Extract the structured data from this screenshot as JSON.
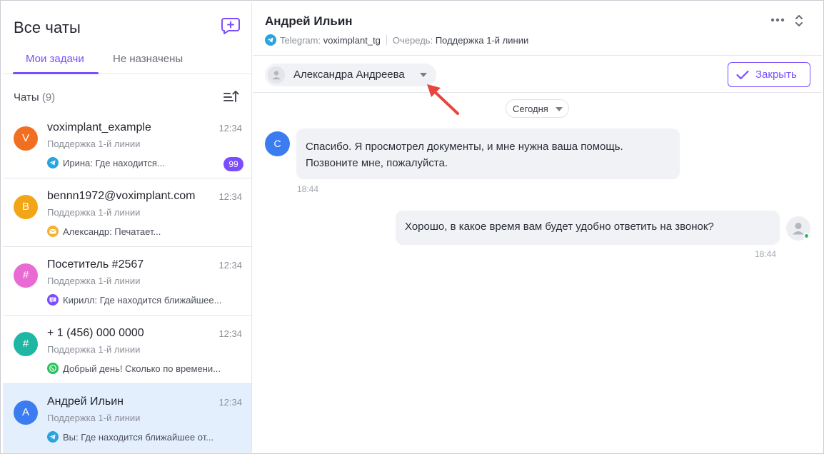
{
  "sidebar": {
    "title": "Все чаты",
    "tabs": [
      {
        "label": "Мои задачи",
        "active": true
      },
      {
        "label": "Не назначены",
        "active": false
      }
    ],
    "chats_label": "Чаты",
    "chats_count": "(9)",
    "chats": [
      {
        "initial": "V",
        "avatar_color": "#f26f21",
        "name": "voximplant_example",
        "time": "12:34",
        "queue": "Поддержка 1-й линии",
        "channel_icon": "telegram-icon",
        "last_message": "Ирина: Где находится...",
        "unread": "99",
        "selected": false
      },
      {
        "initial": "B",
        "avatar_color": "#f2a516",
        "name": "bennn1972@voximplant.com",
        "time": "12:34",
        "queue": "Поддержка 1-й линии",
        "channel_icon": "email-icon",
        "last_message": "Александр: Печатает...",
        "unread": null,
        "selected": false
      },
      {
        "initial": "#",
        "avatar_color": "#e96ad3",
        "name": "Посетитель #2567",
        "time": "12:34",
        "queue": "Поддержка 1-й линии",
        "channel_icon": "webchat-icon",
        "last_message": "Кирилл: Где находится ближайшее...",
        "unread": null,
        "selected": false
      },
      {
        "initial": "#",
        "avatar_color": "#1fb7a3",
        "name": "+ 1 (456) 000 0000",
        "time": "12:34",
        "queue": "Поддержка 1-й линии",
        "channel_icon": "whatsapp-icon",
        "last_message": "Добрый день! Сколько по времени...",
        "unread": null,
        "selected": false
      },
      {
        "initial": "А",
        "avatar_color": "#3b7cf0",
        "name": "Андрей Ильин",
        "time": "12:34",
        "queue": "Поддержка 1-й линии",
        "channel_icon": "telegram-icon",
        "last_message": "Вы: Где находится ближайшее от...",
        "unread": null,
        "selected": true
      }
    ]
  },
  "header": {
    "contact_name": "Андрей Ильин",
    "channel_key": "Telegram:",
    "channel_value": "voximplant_tg",
    "queue_key": "Очередь:",
    "queue_value": "Поддержка 1-й линии"
  },
  "assignee": {
    "name": "Александра Андреева"
  },
  "close_button": {
    "label": "Закрыть"
  },
  "date_filter": {
    "label": "Сегодня"
  },
  "messages": [
    {
      "direction": "in",
      "avatar_initial": "С",
      "text": "Спасибо. Я просмотрел документы, и мне нужна ваша помощь. Позвоните мне, пожалуйста.",
      "time": "18:44"
    },
    {
      "direction": "out",
      "text": "Хорошо, в какое время вам будет удобно ответить на звонок?",
      "time": "18:44"
    }
  ],
  "colors": {
    "accent": "#7c4dff",
    "selected_row": "#e4effe",
    "telegram": "#2aa3e0",
    "online": "#2fb96a",
    "annotation_arrow": "#e8453c"
  }
}
